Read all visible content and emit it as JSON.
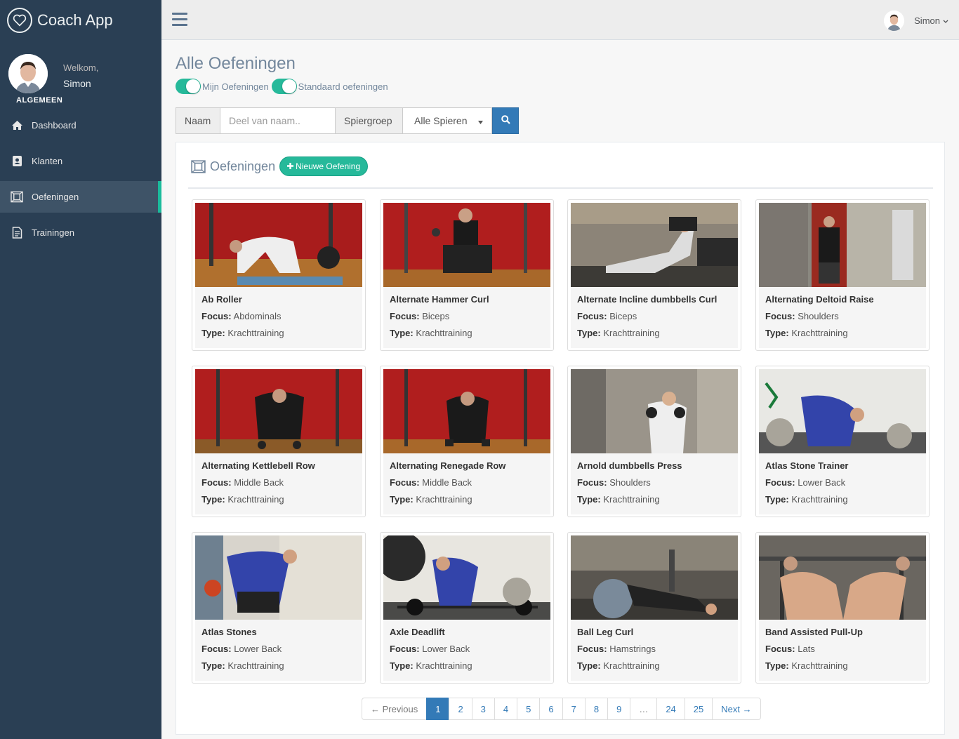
{
  "app": {
    "title": "Coach App"
  },
  "profile": {
    "welcome": "Welkom,",
    "name": "Simon"
  },
  "sidebar": {
    "section": "ALGEMEEN",
    "items": [
      {
        "label": "Dashboard",
        "icon": "home-icon"
      },
      {
        "label": "Klanten",
        "icon": "contact-card-icon"
      },
      {
        "label": "Oefeningen",
        "icon": "exercise-frame-icon",
        "active": true
      },
      {
        "label": "Trainingen",
        "icon": "document-icon"
      }
    ]
  },
  "topnav": {
    "user": "Simon"
  },
  "page": {
    "title": "Alle Oefeningen",
    "toggles": [
      {
        "label": "Mijn Oefeningen",
        "on": true
      },
      {
        "label": "Standaard oefeningen",
        "on": true
      }
    ]
  },
  "search": {
    "name_label": "Naam",
    "name_placeholder": "Deel van naam..",
    "group_label": "Spiergroep",
    "group_value": "Alle Spieren"
  },
  "panel": {
    "title": "Oefeningen",
    "new_button": "Nieuwe Oefening"
  },
  "labels": {
    "focus": "Focus:",
    "type": "Type:"
  },
  "exercises": [
    {
      "name": "Ab Roller",
      "focus": "Abdominals",
      "type": "Krachttraining"
    },
    {
      "name": "Alternate Hammer Curl",
      "focus": "Biceps",
      "type": "Krachttraining"
    },
    {
      "name": "Alternate Incline dumbbells Curl",
      "focus": "Biceps",
      "type": "Krachttraining"
    },
    {
      "name": "Alternating Deltoid Raise",
      "focus": "Shoulders",
      "type": "Krachttraining"
    },
    {
      "name": "Alternating Kettlebell Row",
      "focus": "Middle Back",
      "type": "Krachttraining"
    },
    {
      "name": "Alternating Renegade Row",
      "focus": "Middle Back",
      "type": "Krachttraining"
    },
    {
      "name": "Arnold dumbbells Press",
      "focus": "Shoulders",
      "type": "Krachttraining"
    },
    {
      "name": "Atlas Stone Trainer",
      "focus": "Lower Back",
      "type": "Krachttraining"
    },
    {
      "name": "Atlas Stones",
      "focus": "Lower Back",
      "type": "Krachttraining"
    },
    {
      "name": "Axle Deadlift",
      "focus": "Lower Back",
      "type": "Krachttraining"
    },
    {
      "name": "Ball Leg Curl",
      "focus": "Hamstrings",
      "type": "Krachttraining"
    },
    {
      "name": "Band Assisted Pull-Up",
      "focus": "Lats",
      "type": "Krachttraining"
    }
  ],
  "pagination": {
    "previous": "← Previous",
    "pages": [
      "1",
      "2",
      "3",
      "4",
      "5",
      "6",
      "7",
      "8",
      "9",
      "…",
      "24",
      "25"
    ],
    "next": "Next →",
    "current": "1"
  }
}
